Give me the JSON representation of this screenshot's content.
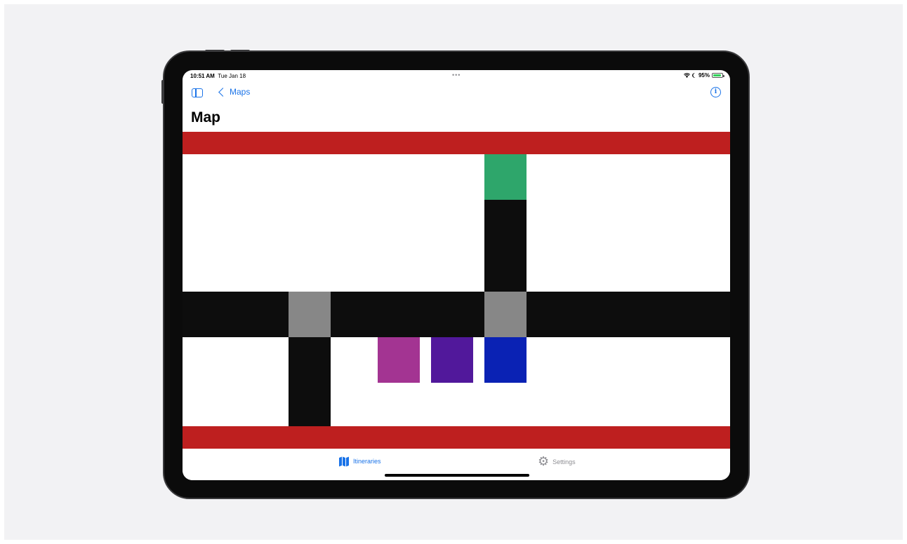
{
  "status_bar": {
    "time": "10:51 AM",
    "date": "Tue Jan 18",
    "dots": "•••",
    "battery": "95%",
    "icons": [
      "wifi-icon",
      "moon-icon",
      "battery-icon"
    ]
  },
  "nav": {
    "back_label": "Maps",
    "title": "Map",
    "icons": [
      "sidebar-toggle-icon",
      "chevron-left-icon",
      "info-icon"
    ]
  },
  "tabs": [
    {
      "label": "Itineraries",
      "icon": "map-icon",
      "selected": true
    },
    {
      "label": "Settings",
      "icon": "gear-icon",
      "selected": false
    }
  ],
  "map": {
    "colors": {
      "boundary": "#be1f1f",
      "road": "#0d0d0d",
      "intersection": "#878787",
      "green": "#2ea66b",
      "magenta": "#a33492",
      "purple": "#51189b",
      "blue": "#0a22b4",
      "background": "#ffffff"
    }
  },
  "accent_color": "#1a73e8"
}
